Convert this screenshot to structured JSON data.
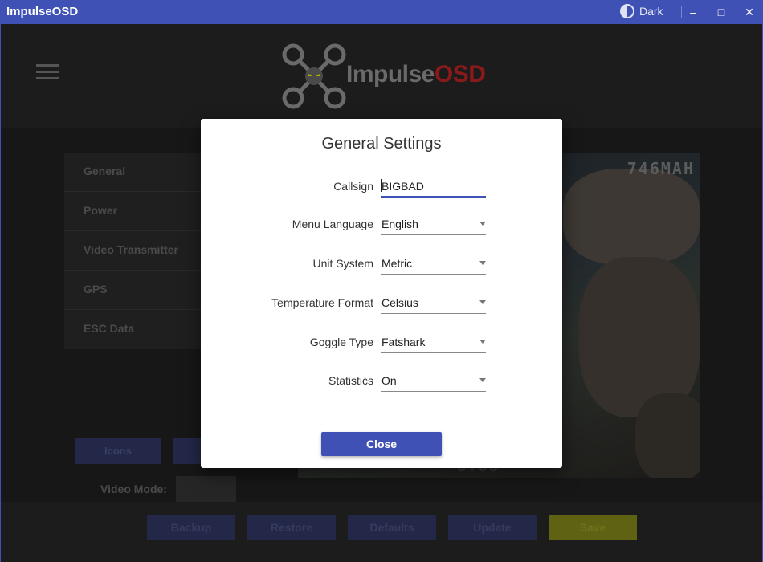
{
  "window": {
    "title": "ImpulseOSD",
    "theme_label": "Dark",
    "minimize": "–",
    "maximize": "□",
    "close": "✕"
  },
  "header": {
    "logo_part1": "Impulse",
    "logo_part2": "OSD"
  },
  "sidebar": {
    "items": [
      {
        "label": "General"
      },
      {
        "label": "Power"
      },
      {
        "label": "Video Transmitter"
      },
      {
        "label": "GPS"
      },
      {
        "label": "ESC Data"
      }
    ]
  },
  "preview": {
    "osd_mah": "746MAH",
    "osd_time": "0:00"
  },
  "controls": {
    "icons_label": "Icons",
    "video_mode_label": "Video Mode:"
  },
  "footer": {
    "buttons": [
      {
        "label": "Backup"
      },
      {
        "label": "Restore"
      },
      {
        "label": "Defaults"
      },
      {
        "label": "Update"
      },
      {
        "label": "Save"
      }
    ]
  },
  "modal": {
    "title": "General Settings",
    "fields": [
      {
        "label": "Callsign",
        "value": "BIGBAD"
      },
      {
        "label": "Menu Language",
        "value": "English"
      },
      {
        "label": "Unit System",
        "value": "Metric"
      },
      {
        "label": "Temperature Format",
        "value": "Celsius"
      },
      {
        "label": "Goggle Type",
        "value": "Fatshark"
      },
      {
        "label": "Statistics",
        "value": "On"
      }
    ],
    "close_label": "Close"
  },
  "colors": {
    "primary": "#3f51b5",
    "logo_accent": "#c62828",
    "save": "#9e9d24"
  }
}
